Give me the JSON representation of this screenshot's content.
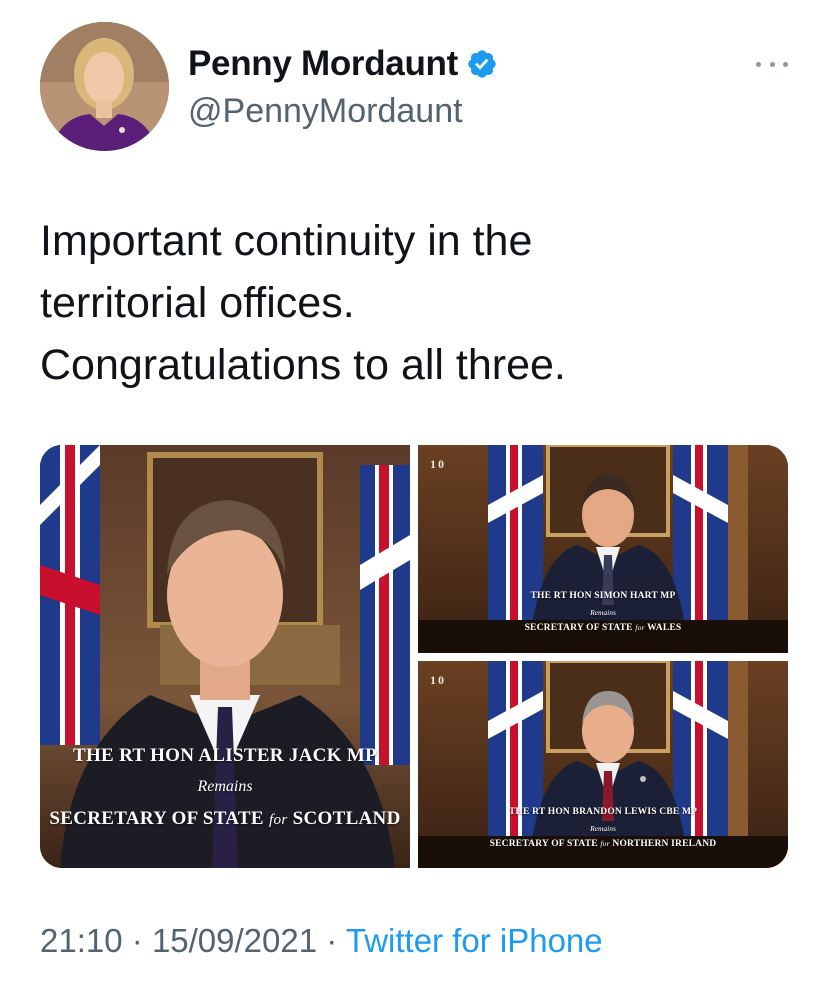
{
  "author": {
    "display_name": "Penny Mordaunt",
    "handle": "@PennyMordaunt",
    "verified": true,
    "verified_color": "#1d9bf0"
  },
  "tweet": {
    "text_lines": [
      "Important continuity in the",
      "territorial offices.",
      "Congratulations to all three."
    ]
  },
  "media": [
    {
      "name_line": "THE RT HON ALISTER JACK MP",
      "status": "Remains",
      "office_prefix": "SECRETARY OF STATE",
      "office_for": "for",
      "office_region": "SCOTLAND"
    },
    {
      "badge": "10",
      "name_line": "THE RT HON SIMON HART MP",
      "status": "Remains",
      "office_prefix": "SECRETARY OF STATE",
      "office_for": "for",
      "office_region": "WALES"
    },
    {
      "badge": "10",
      "name_line": "THE RT HON BRANDON LEWIS CBE MP",
      "status": "Remains",
      "office_prefix": "SECRETARY OF STATE",
      "office_for": "for",
      "office_region": "NORTHERN IRELAND"
    }
  ],
  "footer": {
    "time": "21:10",
    "separator": "·",
    "date": "15/09/2021",
    "source": "Twitter for iPhone"
  },
  "icons": {
    "verified": "verified-badge-icon",
    "more": "more-options-icon"
  },
  "colors": {
    "link": "#1d9bf0",
    "secondary_text": "#536471",
    "primary_text": "#0f1419"
  }
}
